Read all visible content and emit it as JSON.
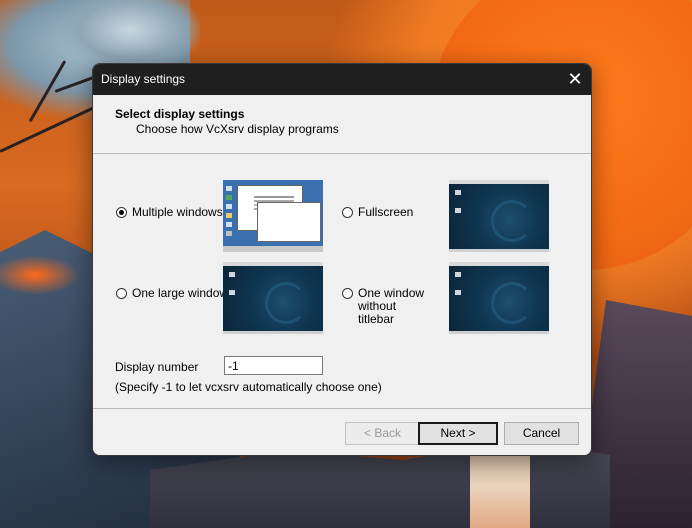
{
  "dialog": {
    "title": "Display settings",
    "heading": "Select display settings",
    "subheading": "Choose how VcXsrv display programs"
  },
  "options": [
    {
      "label": "Multiple windows",
      "checked": true,
      "preview": "multiple-windows-preview"
    },
    {
      "label": "Fullscreen",
      "checked": false,
      "preview": "fullscreen-preview"
    },
    {
      "label": "One large window",
      "checked": false,
      "preview": "one-large-window-preview"
    },
    {
      "label": "One window without titlebar",
      "checked": false,
      "preview": "no-titlebar-preview"
    }
  ],
  "display_number": {
    "label": "Display number",
    "value": "-1",
    "hint": "(Specify -1 to let vcxsrv automatically choose one)"
  },
  "buttons": {
    "back": "< Back",
    "next": "Next >",
    "cancel": "Cancel"
  },
  "icons": {
    "close": "close-icon",
    "radio": "radio-button"
  }
}
